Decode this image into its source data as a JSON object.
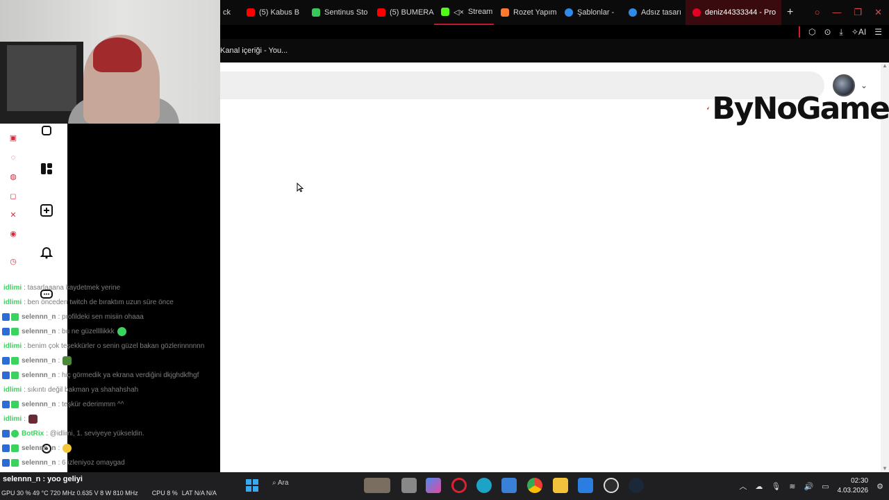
{
  "browser": {
    "tabs": [
      {
        "label": "ck",
        "icon_color": "#ff0000"
      },
      {
        "label": "(5) Kabus B",
        "icon_color": "#ff0000"
      },
      {
        "label": "Sentinus Sto",
        "icon_color": "#38c95a"
      },
      {
        "label": "(5) BUMERA",
        "icon_color": "#ff0000"
      },
      {
        "label": "Stream -",
        "icon_color": "#53fc18"
      },
      {
        "label": "Rozet Yapım",
        "icon_color": "#ff7a2f"
      },
      {
        "label": "Şablonlar - ",
        "icon_color": "#2f8ae8"
      },
      {
        "label": "Adsız tasarı",
        "icon_color": "#2f8ae8"
      },
      {
        "label": "deniz44333344 - Pro",
        "icon_color": "#e60023"
      }
    ],
    "toolbar_ai_label": "AI",
    "bookmark_label": "Kanal içeriği - You..."
  },
  "logo": {
    "text": "ByNoGame"
  },
  "chat": {
    "messages": [
      {
        "user": "idlimi",
        "user_color": "#3cd25f",
        "badge": false,
        "msg": ": tasarlaaana kaydetmek yerine"
      },
      {
        "user": "idlimi",
        "user_color": "#3cd25f",
        "badge": false,
        "msg": ": ben önceden twitch de bıraktım uzun süre önce"
      },
      {
        "user": "selennn_n",
        "user_color": "#7d7d7d",
        "badge": true,
        "msg": ": profildeki sen misiin ohaaa"
      },
      {
        "user": "selennn_n",
        "user_color": "#7d7d7d",
        "badge": true,
        "msg": ": bu ne güzellllikkk"
      },
      {
        "user": "idlimi",
        "user_color": "#3cd25f",
        "badge": false,
        "msg": ": benim çok teşekkürler o senin güzel bakan gözlerinnnnnn"
      },
      {
        "user": "selennn_n",
        "user_color": "#7d7d7d",
        "badge": true,
        "msg": ":"
      },
      {
        "user": "selennn_n",
        "user_color": "#7d7d7d",
        "badge": true,
        "msg": ": hiç görmedik ya ekrana verdiğini dkjghdkfhgf"
      },
      {
        "user": "idlimi",
        "user_color": "#3cd25f",
        "badge": false,
        "msg": ": sıkıntı değil bakman ya shahahshah"
      },
      {
        "user": "selennn_n",
        "user_color": "#7d7d7d",
        "badge": true,
        "msg": ": teşkür ederimmm ^^"
      },
      {
        "user": "idlimi",
        "user_color": "#3cd25f",
        "badge": false,
        "msg": ":"
      },
      {
        "user": "BotRix",
        "user_color": "#3cd25f",
        "badge": true,
        "msg": ": @idlimi, 1. seviyeye yükseldin."
      },
      {
        "user": "selennn_n",
        "user_color": "#7d7d7d",
        "badge": true,
        "msg": ":"
      },
      {
        "user": "selennn_n",
        "user_color": "#7d7d7d",
        "badge": true,
        "msg": ": 6 izleniyoz omaygad"
      }
    ],
    "overlay_line": "selennn_n : yoo geliyi"
  },
  "taskbar": {
    "perf_top": "GPU 30 % 49 °C 720 MHz 0.635 V 8 W 810 MHz",
    "cpu": "CPU 8 %",
    "lat": "LAT N/A N/A",
    "search_label": "Ara",
    "time": "02:30",
    "date": "4.03.2026"
  }
}
